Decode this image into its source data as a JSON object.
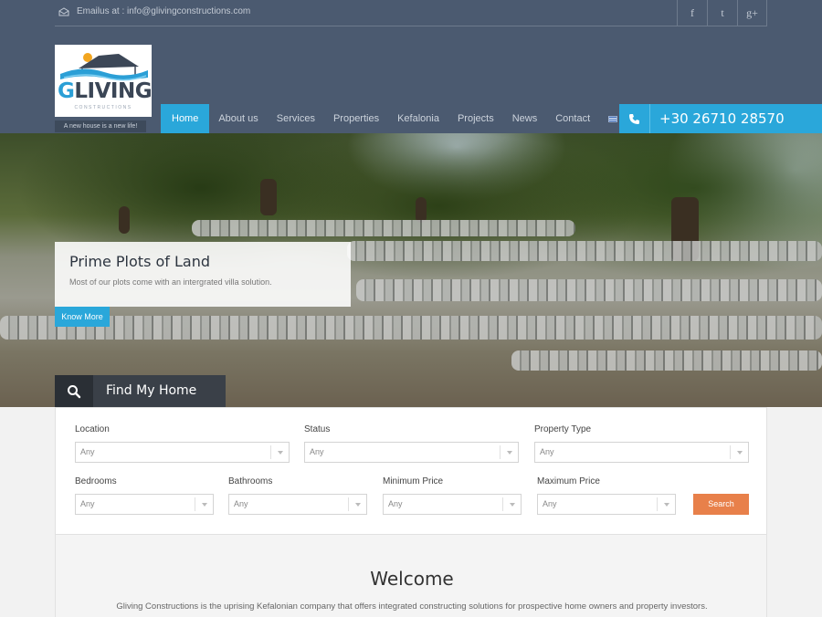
{
  "header": {
    "email_text": "Emailus at : info@glivingconstructions.com",
    "socials": [
      {
        "icon": "facebook-icon",
        "glyph": "f"
      },
      {
        "icon": "twitter-icon",
        "glyph": "t"
      },
      {
        "icon": "google-plus-icon",
        "glyph": "g+"
      }
    ],
    "logo": {
      "letter_g": "G",
      "word": "LIVING",
      "sub": "CONSTRUCTIONS"
    },
    "tagline": "A new house is a new life!",
    "nav": [
      "Home",
      "About us",
      "Services",
      "Properties",
      "Kefalonia",
      "Projects",
      "News",
      "Contact"
    ],
    "active_nav": "Home",
    "phone": "+30 26710 28570"
  },
  "hero": {
    "title": "Prime Plots of Land",
    "text": "Most of our plots come with an intergrated villa solution.",
    "button": "Know More",
    "find_label": "Find My Home"
  },
  "search": {
    "location": {
      "label": "Location",
      "value": "Any"
    },
    "status": {
      "label": "Status",
      "value": "Any"
    },
    "property_type": {
      "label": "Property Type",
      "value": "Any"
    },
    "bedrooms": {
      "label": "Bedrooms",
      "value": "Any"
    },
    "bathrooms": {
      "label": "Bathrooms",
      "value": "Any"
    },
    "min_price": {
      "label": "Minimum Price",
      "value": "Any"
    },
    "max_price": {
      "label": "Maximum Price",
      "value": "Any"
    },
    "button": "Search"
  },
  "welcome": {
    "title": "Welcome",
    "text": "Gliving Constructions is the uprising Kefalonian company that offers integrated constructing solutions for prospective home owners and property investors."
  },
  "colors": {
    "header_bg": "#4b5a70",
    "accent": "#2aa7da",
    "search_button": "#e8804a"
  }
}
